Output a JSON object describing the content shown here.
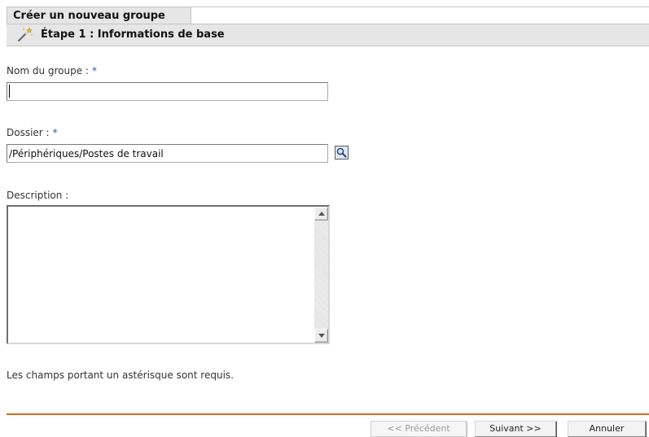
{
  "header": {
    "title": "Créer un nouveau groupe",
    "step_title": "Étape 1 : Informations de base",
    "step_icon": "wizard-wand-icon"
  },
  "form": {
    "group_name": {
      "label": "Nom du groupe :",
      "required_marker": "*",
      "value": ""
    },
    "folder": {
      "label": "Dossier :",
      "required_marker": "*",
      "value": "/Périphériques/Postes de travail",
      "browse_icon": "magnifier-icon"
    },
    "description": {
      "label": "Description :",
      "value": ""
    },
    "required_note": "Les champs portant un astérisque sont requis."
  },
  "footer": {
    "previous_label": "<< Précédent",
    "next_label": "Suivant >>",
    "cancel_label": "Annuler",
    "rule_color": "#e06a1a"
  }
}
